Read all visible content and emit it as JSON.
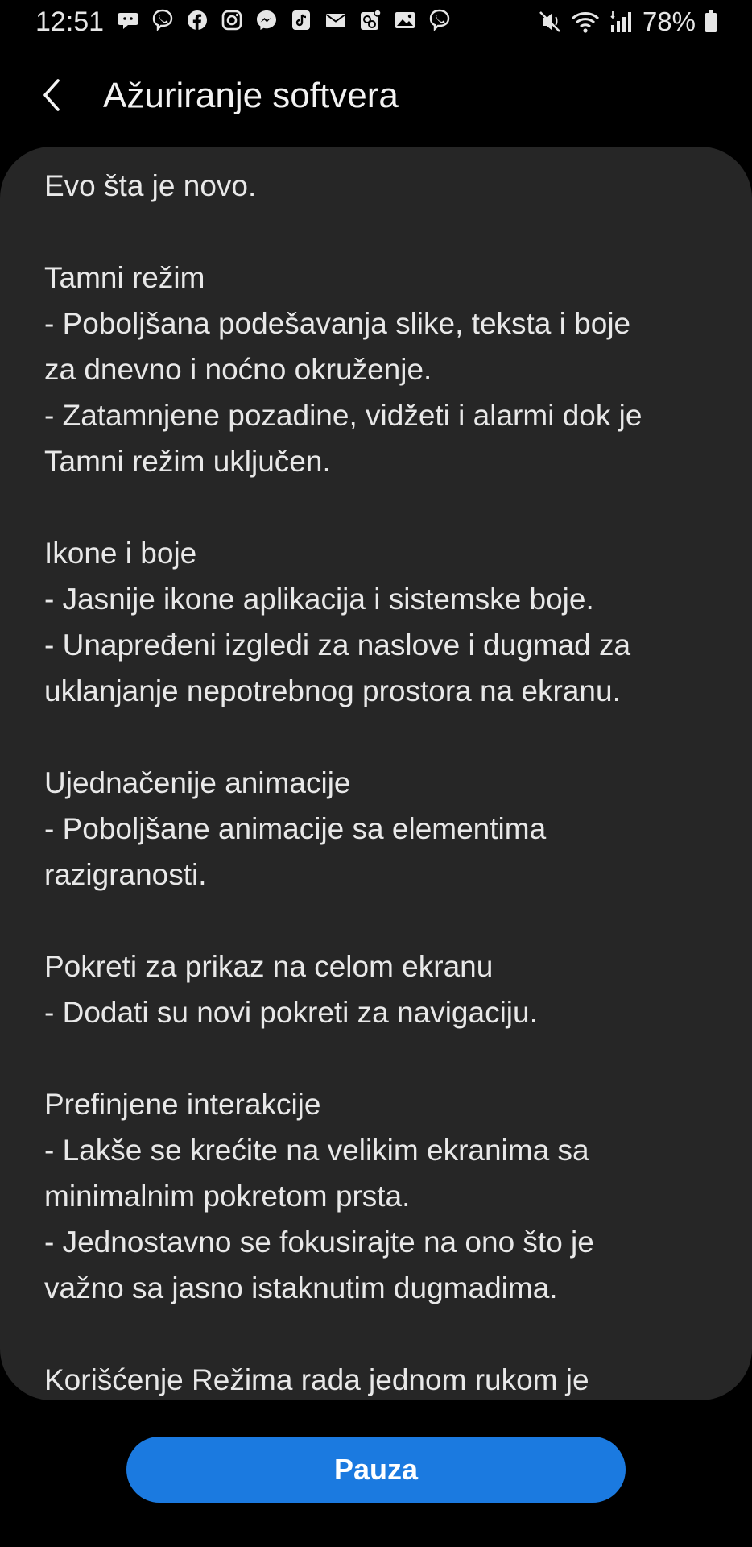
{
  "status_bar": {
    "time": "12:51",
    "battery_percent": "78%",
    "notification_icons": [
      "chat-bubble-icon",
      "viber-icon",
      "facebook-icon",
      "instagram-icon",
      "messenger-icon",
      "tiktok-icon",
      "mail-icon",
      "gallery-badge-icon",
      "image-icon",
      "viber-icon"
    ],
    "system_icons": [
      "mute-icon",
      "wifi-icon",
      "signal-icon",
      "battery-icon"
    ]
  },
  "app_bar": {
    "title": "Ažuriranje softvera",
    "back_icon": "back-arrow-icon"
  },
  "content": {
    "lines": [
      "Evo šta je novo.",
      "",
      "Tamni režim",
      "- Poboljšana podešavanja slike, teksta i boje",
      "za dnevno i noćno okruženje.",
      "- Zatamnjene pozadine, vidžeti i alarmi dok je",
      "Tamni režim uključen.",
      "",
      "Ikone i boje",
      "- Jasnije ikone aplikacija i sistemske boje.",
      "- Unapređeni izgledi za naslove i dugmad za",
      "uklanjanje nepotrebnog prostora na ekranu.",
      "",
      "Ujednačenije animacije",
      "- Poboljšane animacije sa elementima",
      "razigranosti.",
      "",
      "Pokreti za prikaz na celom ekranu",
      "- Dodati su novi pokreti za navigaciju.",
      "",
      "Prefinjene interakcije",
      "- Lakše se krećite na velikim ekranima sa",
      "minimalnim pokretom prsta.",
      "- Jednostavno se fokusirajte na ono što je",
      "važno sa jasno istaknutim dugmadima.",
      "",
      "Korišćenje Režima rada jednom rukom je"
    ]
  },
  "actions": {
    "pause_label": "Pauza"
  },
  "colors": {
    "background": "#000000",
    "card": "#262626",
    "accent": "#1b7ae0",
    "text": "#e8e8e8"
  }
}
